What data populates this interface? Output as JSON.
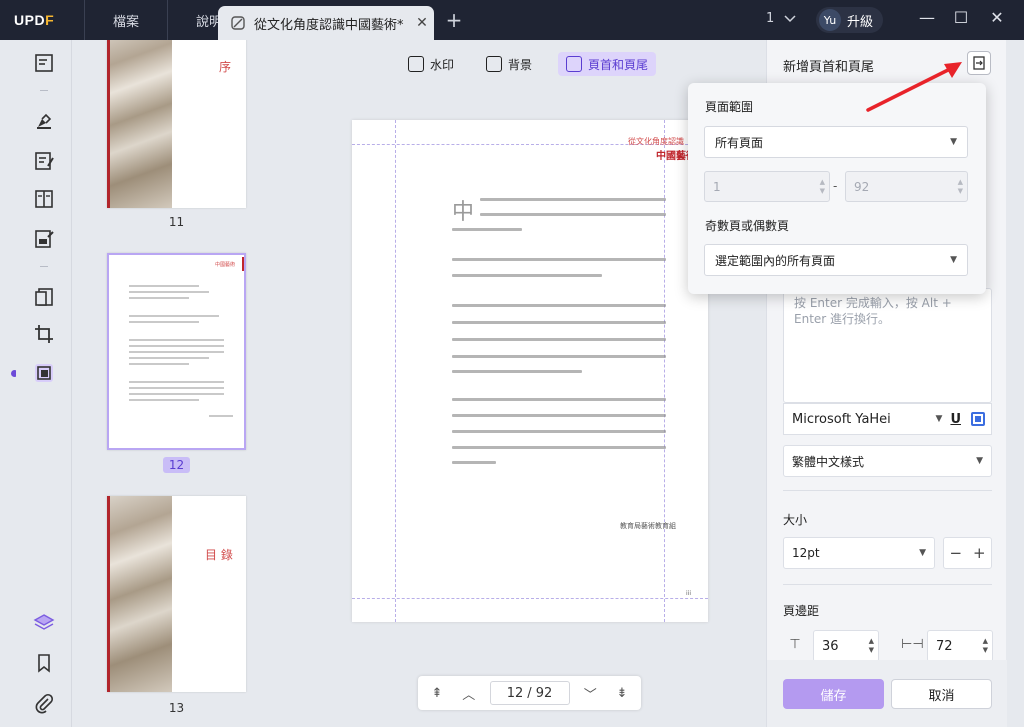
{
  "app": {
    "logo_text": "UPDF",
    "menu": [
      "檔案",
      "說明"
    ],
    "tab_title": "從文化角度認識中國藝術*",
    "window_count": "1",
    "user_initials": "Yu",
    "upgrade_label": "升級"
  },
  "thumbnails": [
    {
      "page_label": "11",
      "red_text": "序"
    },
    {
      "page_label": "12",
      "red_text": "中國藝術"
    },
    {
      "page_label": "13",
      "red_text": "目 錄"
    }
  ],
  "toolbar": {
    "watermark": "水印",
    "background": "背景",
    "header_footer": "頁首和頁尾"
  },
  "document": {
    "header_small": "從文化角度認識",
    "header_large": "中國藝術",
    "first_char": "中",
    "signature": "教育局藝術教育組",
    "page_number": "iii"
  },
  "navigation": {
    "current_page": "12",
    "separator": "/",
    "total_pages": "92"
  },
  "panel": {
    "title": "新增頁首和頁尾",
    "text_placeholder": "按 Enter 完成輸入，按 Alt + Enter 進行換行。",
    "font_name": "Microsoft YaHei",
    "underline_label": "U",
    "style_select": "繁體中文樣式",
    "size_label": "大小",
    "size_value": "12pt",
    "minus_label": "−",
    "plus_label": "+",
    "margin_label": "頁邊距",
    "margin_top": "36",
    "margin_side": "72",
    "save_label": "儲存",
    "cancel_label": "取消",
    "accent_color": "#b49af0",
    "font_color": "#3c6ee0"
  },
  "popup": {
    "page_range_label": "頁面範圍",
    "page_range_value": "所有頁面",
    "range_from": "1",
    "range_to": "92",
    "range_dash": "-",
    "odd_even_label": "奇數頁或偶數頁",
    "odd_even_value": "選定範圍內的所有頁面"
  }
}
